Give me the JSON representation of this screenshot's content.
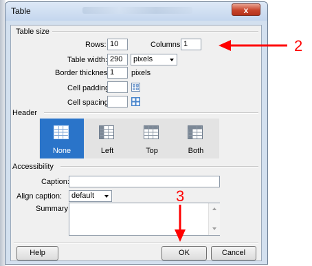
{
  "window": {
    "title": "Table",
    "close_glyph": "x"
  },
  "table_size": {
    "legend": "Table size",
    "rows_label": "Rows:",
    "rows_value": "10",
    "columns_label": "Columns:",
    "columns_value": "1",
    "width_label": "Table width:",
    "width_value": "290",
    "width_unit": "pixels",
    "border_label": "Border thickness:",
    "border_value": "1",
    "border_unit": "pixels",
    "padding_label": "Cell padding:",
    "padding_value": "",
    "spacing_label": "Cell spacing:",
    "spacing_value": ""
  },
  "header": {
    "legend": "Header",
    "options": [
      {
        "label": "None",
        "selected": true
      },
      {
        "label": "Left",
        "selected": false
      },
      {
        "label": "Top",
        "selected": false
      },
      {
        "label": "Both",
        "selected": false
      }
    ]
  },
  "accessibility": {
    "legend": "Accessibility",
    "caption_label": "Caption:",
    "caption_value": "",
    "align_label": "Align caption:",
    "align_value": "default",
    "summary_label": "Summary:",
    "summary_value": ""
  },
  "buttons": {
    "help": "Help",
    "ok": "OK",
    "cancel": "Cancel"
  },
  "annotations": {
    "step2": "2",
    "step3": "3"
  },
  "colors": {
    "annotation": "#ff0000",
    "selected": "#2a74c9",
    "close": "#c7432a"
  },
  "icons": {
    "padding": "cell-padding-icon",
    "spacing": "cell-spacing-icon",
    "arrow": "annotation-arrow-icon"
  }
}
